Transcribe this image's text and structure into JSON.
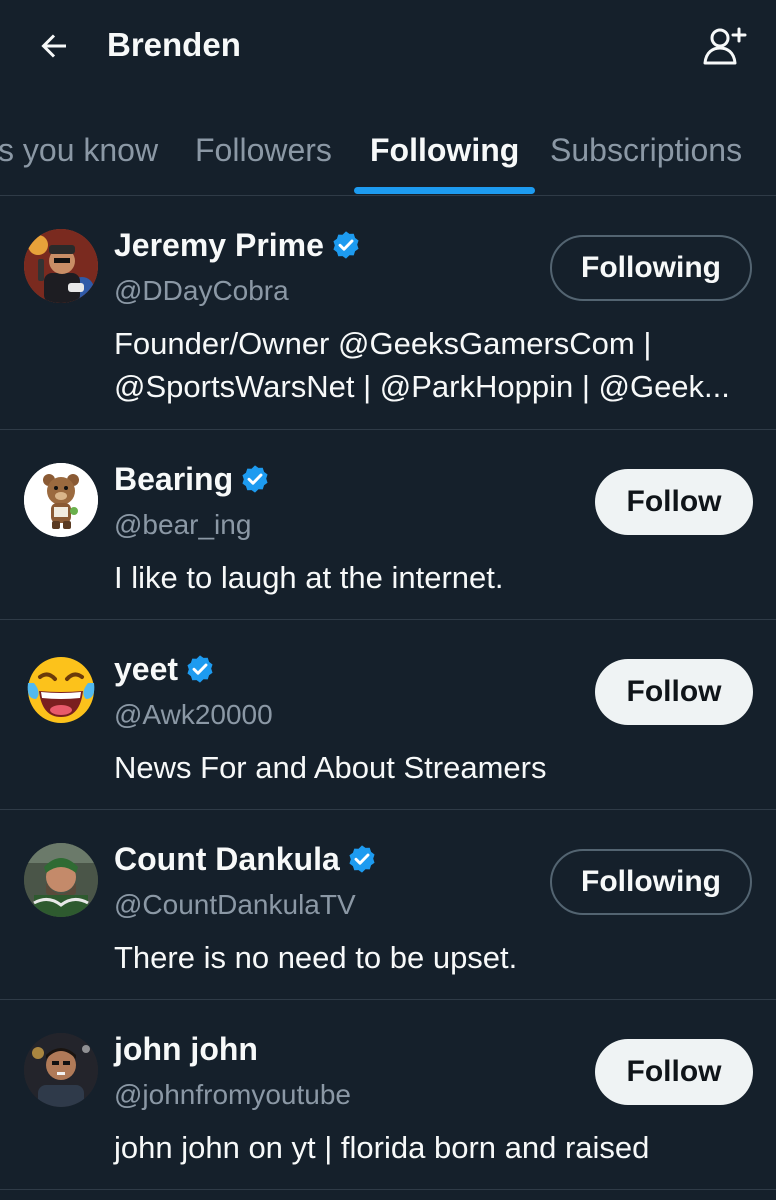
{
  "header": {
    "title": "Brenden"
  },
  "tabs": [
    {
      "label": "s you know"
    },
    {
      "label": "Followers"
    },
    {
      "label": "Following"
    },
    {
      "label": "Subscriptions"
    }
  ],
  "users": [
    {
      "name": "Jeremy Prime",
      "handle": "@DDayCobra",
      "bio_line1": "Founder/Owner @GeeksGamersCom |",
      "bio_line2": "@SportsWarsNet | @ParkHoppin | @Geek...",
      "button": "Following"
    },
    {
      "name": "Bearing",
      "handle": "@bear_ing",
      "bio_line1": "I like to laugh at the internet.",
      "button": "Follow"
    },
    {
      "name": "yeet",
      "handle": "@Awk20000",
      "bio_line1": "News For and About Streamers",
      "button": "Follow"
    },
    {
      "name": "Count Dankula",
      "handle": "@CountDankulaTV",
      "bio_line1": "There is no need to be upset.",
      "button": "Following"
    },
    {
      "name": "john john",
      "handle": "@johnfromyoutube",
      "bio_line1": "john john on yt | florida born and raised",
      "button": "Follow"
    }
  ],
  "colors": {
    "background": "#15202b",
    "accent": "#1d9bf0",
    "muted": "#8b98a5"
  }
}
